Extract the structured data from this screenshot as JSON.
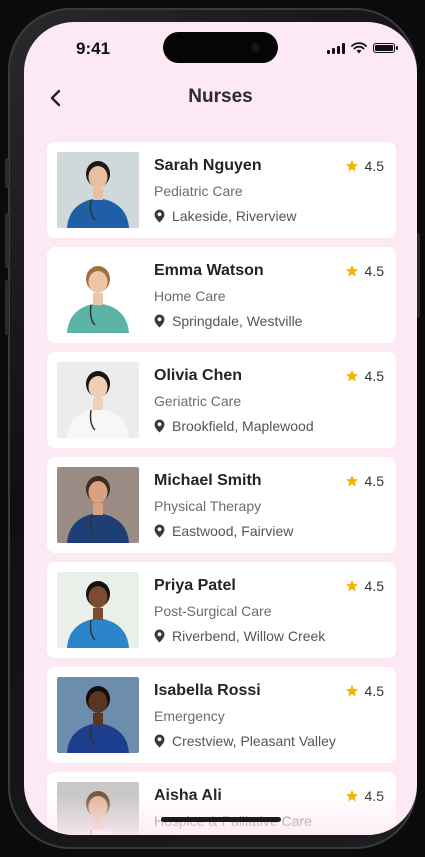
{
  "status_bar": {
    "time": "9:41"
  },
  "header": {
    "title": "Nurses"
  },
  "theme": {
    "background": "#fde9f3",
    "card": "#ffffff",
    "star": "#f5b400"
  },
  "nurses": [
    {
      "name": "Sarah Nguyen",
      "specialty": "Pediatric Care",
      "location": "Lakeside, Riverview",
      "rating": "4.5",
      "photo_bg": "#cfd9dc",
      "scrub": "#1f5fa8",
      "skin": "#e8bfa0",
      "hair": "#1d1715"
    },
    {
      "name": "Emma Watson",
      "specialty": "Home Care",
      "location": "Springdale, Westville",
      "rating": "4.5",
      "photo_bg": "#ffffff",
      "scrub": "#5bb3a6",
      "skin": "#eec5a6",
      "hair": "#a0703f"
    },
    {
      "name": "Olivia Chen",
      "specialty": "Geriatric Care",
      "location": "Brookfield, Maplewood",
      "rating": "4.5",
      "photo_bg": "#ececec",
      "scrub": "#f7f7f7",
      "skin": "#f0cfb5",
      "hair": "#1a1512"
    },
    {
      "name": "Michael Smith",
      "specialty": "Physical Therapy",
      "location": "Eastwood, Fairview",
      "rating": "4.5",
      "photo_bg": "#9a8b84",
      "scrub": "#1e3f73",
      "skin": "#d9a17f",
      "hair": "#3c2b22"
    },
    {
      "name": "Priya Patel",
      "specialty": "Post-Surgical Care",
      "location": "Riverbend, Willow Creek",
      "rating": "4.5",
      "photo_bg": "#e9efe9",
      "scrub": "#2a86c8",
      "skin": "#7b4c31",
      "hair": "#161010"
    },
    {
      "name": "Isabella Rossi",
      "specialty": "Emergency",
      "location": "Crestview, Pleasant Valley",
      "rating": "4.5",
      "photo_bg": "#6c8dab",
      "scrub": "#1d3d8f",
      "skin": "#5a3522",
      "hair": "#120d0b"
    },
    {
      "name": "Aisha Ali",
      "specialty": "Hospice & Palliative Care",
      "location": "",
      "rating": "4.5",
      "photo_bg": "#c8c8c8",
      "scrub": "#dfe6ee",
      "skin": "#e2b698",
      "hair": "#7a5a3e"
    }
  ]
}
